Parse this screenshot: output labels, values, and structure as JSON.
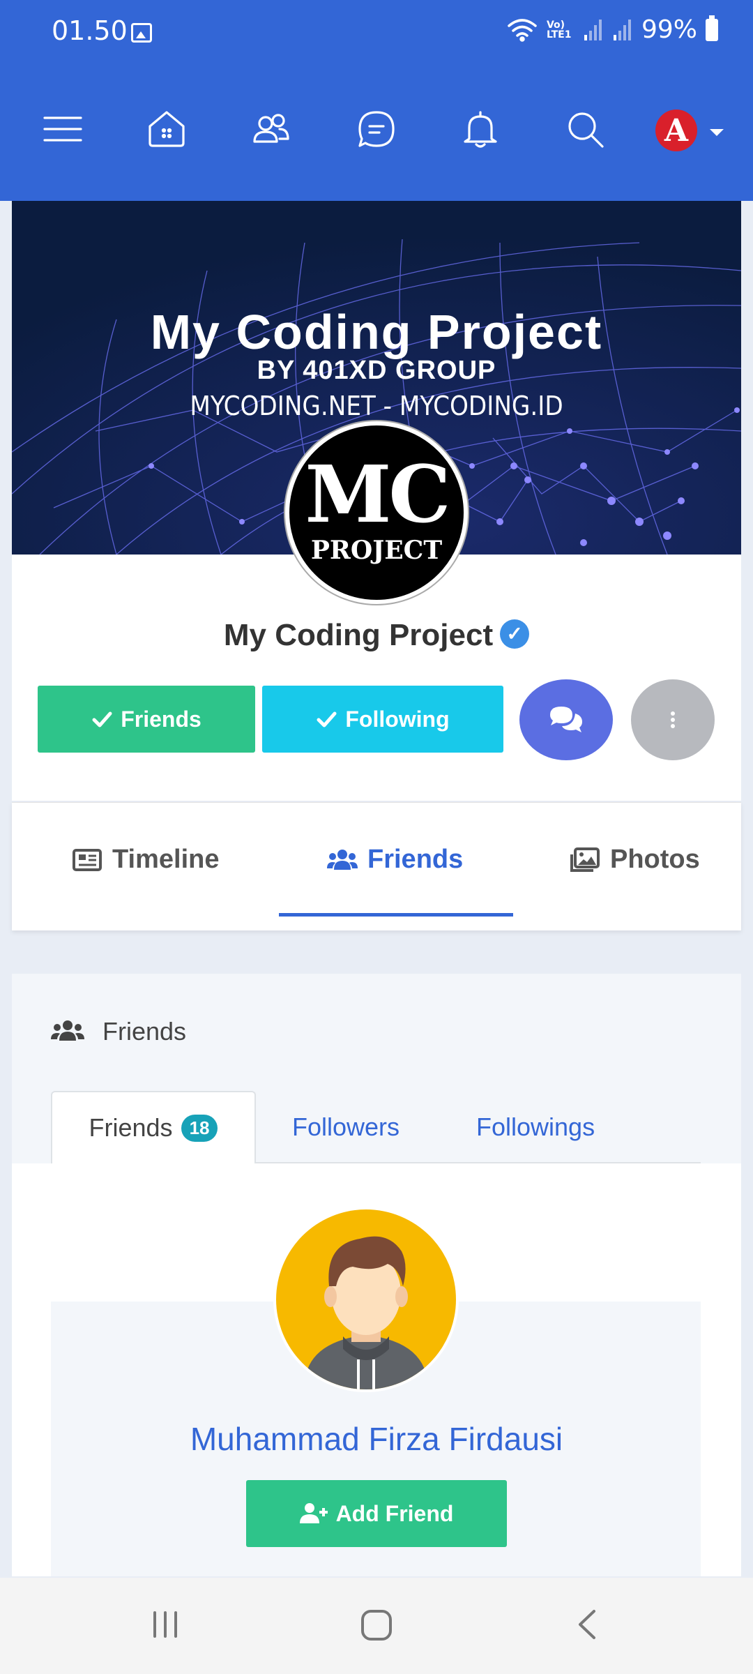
{
  "status_bar": {
    "time": "01.50",
    "network_label": "Vo) LTE1",
    "battery": "99%"
  },
  "cover": {
    "title": "My Coding Project",
    "subtitle": "BY 401XD GROUP",
    "domains": "MYCODING.NET - MYCODING.ID"
  },
  "profile_pic": {
    "line1": "MC",
    "line2": "PROJECT"
  },
  "profile": {
    "name": "My Coding Project",
    "verified": true,
    "avatar_letter": "A"
  },
  "actions": {
    "friends_label": "Friends",
    "following_label": "Following"
  },
  "tabs": [
    {
      "label": "Timeline",
      "icon": "newspaper-icon"
    },
    {
      "label": "Friends",
      "icon": "users-icon",
      "active": true
    },
    {
      "label": "Photos",
      "icon": "images-icon"
    }
  ],
  "friends_panel": {
    "title": "Friends",
    "subtabs": [
      {
        "label": "Friends",
        "count": "18",
        "active": true
      },
      {
        "label": "Followers"
      },
      {
        "label": "Followings"
      }
    ]
  },
  "friend": {
    "name": "Muhammad Firza Firdausi",
    "add_label": "Add Friend"
  },
  "colors": {
    "primary": "#3366d6",
    "success": "#2ec48a",
    "info": "#18c9ea",
    "chat": "#5b6ee2",
    "badge": "#17a2b8"
  }
}
